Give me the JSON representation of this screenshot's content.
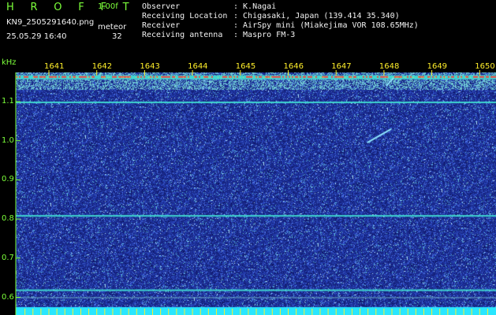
{
  "header": {
    "title": "H R O F F T",
    "version": "1.00f",
    "filename": "KN9_2505291640.png",
    "meteor_label": "meteor",
    "meteor_count": "32",
    "datetime": "25.05.29 16:40"
  },
  "metadata": [
    {
      "key": "Observer",
      "value": ": K.Nagai"
    },
    {
      "key": "Receiving Location",
      "value": ": Chigasaki, Japan (139.414 35.340)"
    },
    {
      "key": "Receiver",
      "value": ": AirSpy mini (Miakejima VOR 108.65MHz)"
    },
    {
      "key": "Receiving antenna",
      "value": ": Maspro FM-3"
    }
  ],
  "colors": {
    "background": "#1a2a8c",
    "noise_light": "#6ea0ff",
    "noise_cyan": "#62e0e0",
    "carrier_line": "#3fd6d0",
    "hot": "#ff3a3a",
    "label_green": "#7cff3a",
    "label_yellow": "#ffef2a",
    "bottom_band": "#29e6ff"
  },
  "chart_data": {
    "type": "heatmap",
    "y_unit": "kHz",
    "yticks": [
      1.1,
      1.0,
      0.9,
      0.8,
      0.7,
      0.6
    ],
    "ytick_labels": [
      "1.1",
      "1.0",
      "0.9",
      "0.8",
      "0.7",
      "0.6"
    ],
    "xticks": [
      1641,
      1642,
      1643,
      1644,
      1645,
      1646,
      1647,
      1648,
      1649,
      1650
    ],
    "xtick_labels": [
      "1641",
      "1642",
      "1643",
      "1644",
      "1645",
      "1646",
      "1647",
      "1648",
      "1649",
      "1650"
    ],
    "xlim": [
      1640.5,
      1650.3
    ],
    "ylim": [
      0.575,
      1.195
    ],
    "horizontal_lines_khz": [
      1.163,
      1.1,
      0.81,
      0.62,
      0.6
    ],
    "meteor_echoes": [
      {
        "x_start": 1647.65,
        "x_end": 1648.15,
        "y_start": 0.995,
        "y_end": 1.03
      },
      {
        "x_start": 1648.05,
        "x_end": 1648.2,
        "y_start": 1.14,
        "y_end": 1.16
      }
    ]
  }
}
